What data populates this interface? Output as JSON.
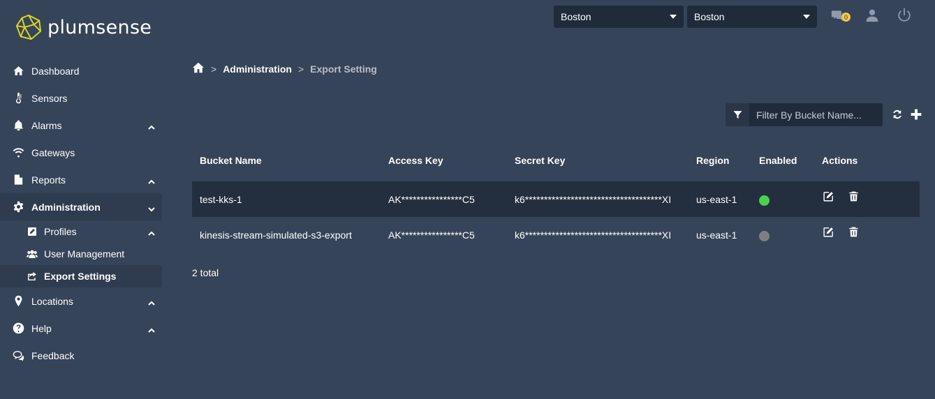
{
  "app": {
    "brand": "plumsense"
  },
  "header": {
    "select_1": "Boston",
    "select_2": "Boston",
    "notification_count": "0"
  },
  "sidebar": {
    "items": [
      {
        "label": "Dashboard",
        "icon": "home-icon"
      },
      {
        "label": "Sensors",
        "icon": "thermometer-icon"
      },
      {
        "label": "Alarms",
        "icon": "bell-icon"
      },
      {
        "label": "Gateways",
        "icon": "wifi-icon"
      },
      {
        "label": "Reports",
        "icon": "file-icon"
      },
      {
        "label": "Administration",
        "icon": "gear-icon"
      },
      {
        "label": "Locations",
        "icon": "map-marker-icon"
      },
      {
        "label": "Help",
        "icon": "question-icon"
      },
      {
        "label": "Feedback",
        "icon": "comments-icon"
      }
    ],
    "admin_sub": [
      {
        "label": "Profiles",
        "icon": "edit-icon"
      },
      {
        "label": "User Management",
        "icon": "users-icon"
      },
      {
        "label": "Export Settings",
        "icon": "share-icon"
      }
    ]
  },
  "breadcrumb": {
    "sep": ">",
    "level_1": "Administration",
    "level_2": "Export Setting"
  },
  "filter": {
    "placeholder": "Filter By Bucket Name..."
  },
  "table": {
    "columns": [
      "Bucket Name",
      "Access Key",
      "Secret Key",
      "Region",
      "Enabled",
      "Actions"
    ],
    "rows": [
      {
        "bucket": "test-kks-1",
        "access_key": "AK****************C5",
        "secret_key": "k6************************************XI",
        "region": "us-east-1",
        "enabled": true,
        "enabled_color": "#4cd04c"
      },
      {
        "bucket": "kinesis-stream-simulated-s3-export",
        "access_key": "AK****************C5",
        "secret_key": "k6************************************XI",
        "region": "us-east-1",
        "enabled": false,
        "enabled_color": "#7f7f7f"
      }
    ]
  },
  "footer": {
    "total": "2 total"
  },
  "colors": {
    "background": "#36445a",
    "panel": "#1f2a3a",
    "logo": "#e2d91e"
  }
}
